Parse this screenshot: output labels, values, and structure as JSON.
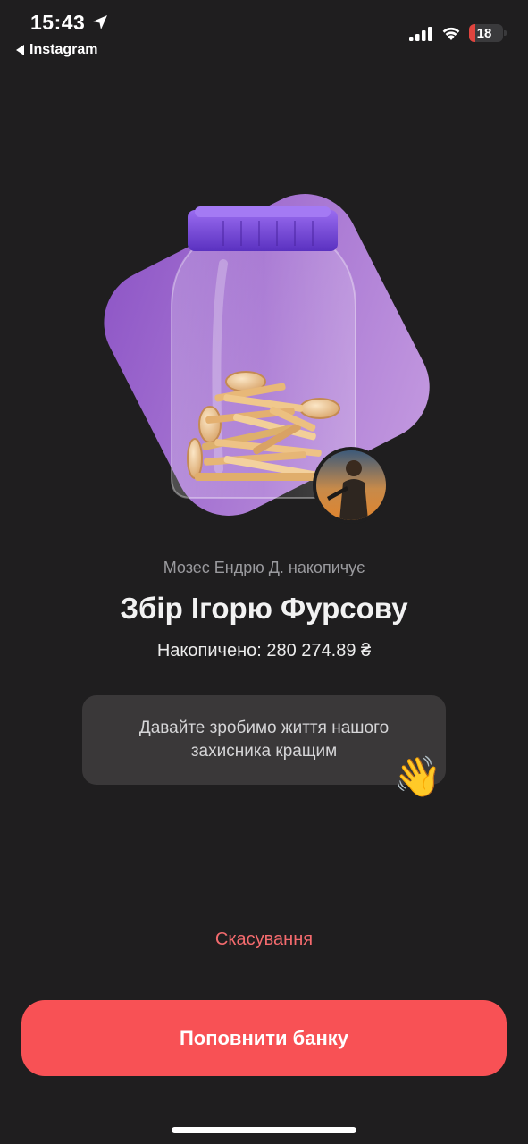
{
  "status_bar": {
    "time": "15:43",
    "back_app": "Instagram",
    "battery": "18",
    "battery_level": 0.18
  },
  "jar": {
    "owner_text": "Мозес Ендрю Д. накопичує",
    "title": "Збір Ігорю Фурсову",
    "accumulated": "Накопичено: 280 274.89 ₴"
  },
  "message": {
    "text": "Давайте зробимо життя нашого захисника кращим",
    "emoji": "👋"
  },
  "actions": {
    "cancel_label": "Скасування",
    "topup_label": "Поповнити банку"
  },
  "colors": {
    "background": "#1f1e1f",
    "accent": "#f85155",
    "purple": "#8e5ccc"
  }
}
